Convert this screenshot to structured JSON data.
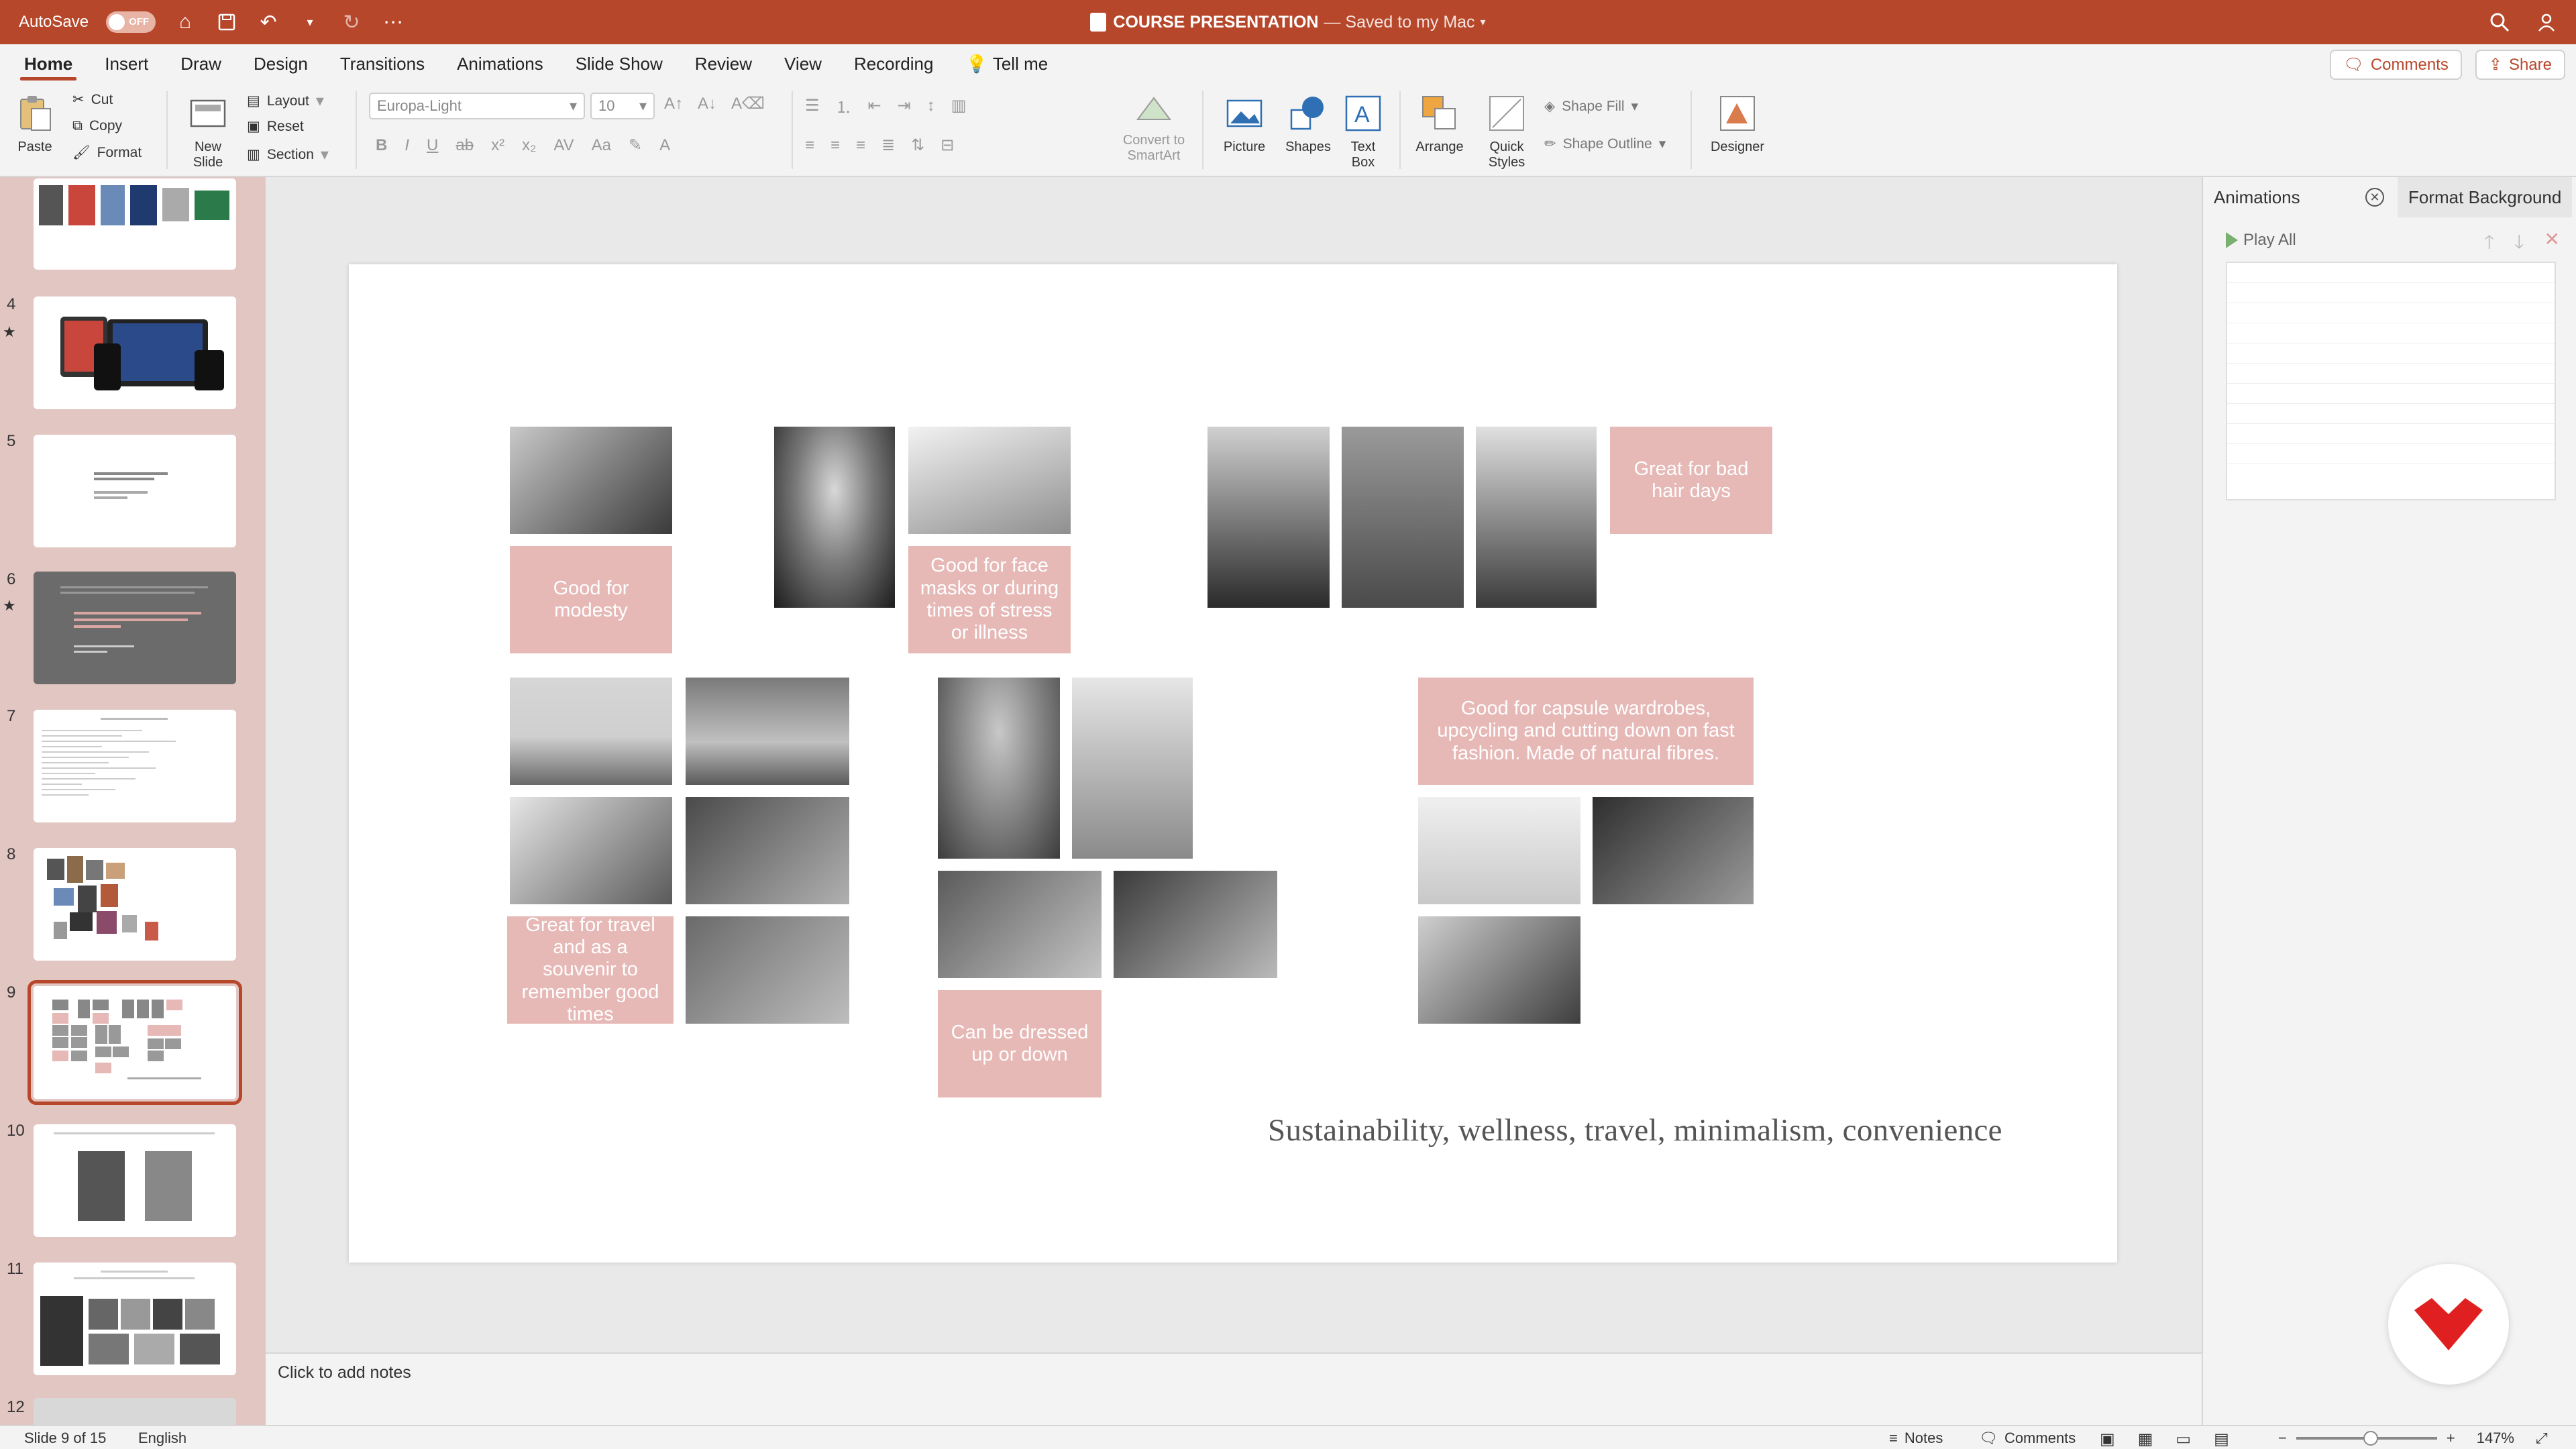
{
  "titlebar": {
    "autosave_label": "AutoSave",
    "autosave_state": "OFF",
    "doc_title": "COURSE PRESENTATION",
    "doc_status": "— Saved to my Mac",
    "accent": "#b7472a"
  },
  "tabs": {
    "items": [
      "Home",
      "Insert",
      "Draw",
      "Design",
      "Transitions",
      "Animations",
      "Slide Show",
      "Review",
      "View",
      "Recording"
    ],
    "active": "Home",
    "tell_me": "Tell me",
    "comments": "Comments",
    "share": "Share"
  },
  "ribbon": {
    "paste": "Paste",
    "cut": "Cut",
    "copy": "Copy",
    "format": "Format",
    "new_slide_line1": "New",
    "new_slide_line2": "Slide",
    "layout": "Layout",
    "reset": "Reset",
    "section": "Section",
    "font_name": "Europa-Light",
    "font_size": "10",
    "convert_line1": "Convert to",
    "convert_line2": "SmartArt",
    "picture": "Picture",
    "shapes": "Shapes",
    "textbox_line1": "Text",
    "textbox_line2": "Box",
    "arrange": "Arrange",
    "quick_line1": "Quick",
    "quick_line2": "Styles",
    "shape_fill": "Shape Fill",
    "shape_outline": "Shape Outline",
    "designer": "Designer"
  },
  "thumbnails": {
    "numbers": [
      "4",
      "5",
      "6",
      "7",
      "8",
      "9",
      "10",
      "11",
      "12"
    ],
    "star_marker": "★",
    "selected": "9"
  },
  "slide": {
    "captions": {
      "modesty": "Good for modesty",
      "face_masks": "Good for face masks or during times of stress or illness",
      "bad_hair": "Great for bad hair days",
      "capsule": "Good for capsule wardrobes, upcycling and cutting down on fast fashion. Made of natural fibres.",
      "travel": "Great for travel and as a souvenir to remember good times",
      "dressed": "Can be dressed up or down"
    },
    "footer": "Sustainability, wellness, travel, minimalism, convenience",
    "caption_color": "#e6b8b6"
  },
  "notes": {
    "placeholder": "Click to add notes"
  },
  "right_pane": {
    "tab_animations": "Animations",
    "tab_format_bg": "Format Background",
    "play_all": "Play All"
  },
  "statusbar": {
    "slide_info": "Slide 9 of 15",
    "language": "English",
    "notes": "Notes",
    "comments": "Comments",
    "zoom": "147%"
  }
}
